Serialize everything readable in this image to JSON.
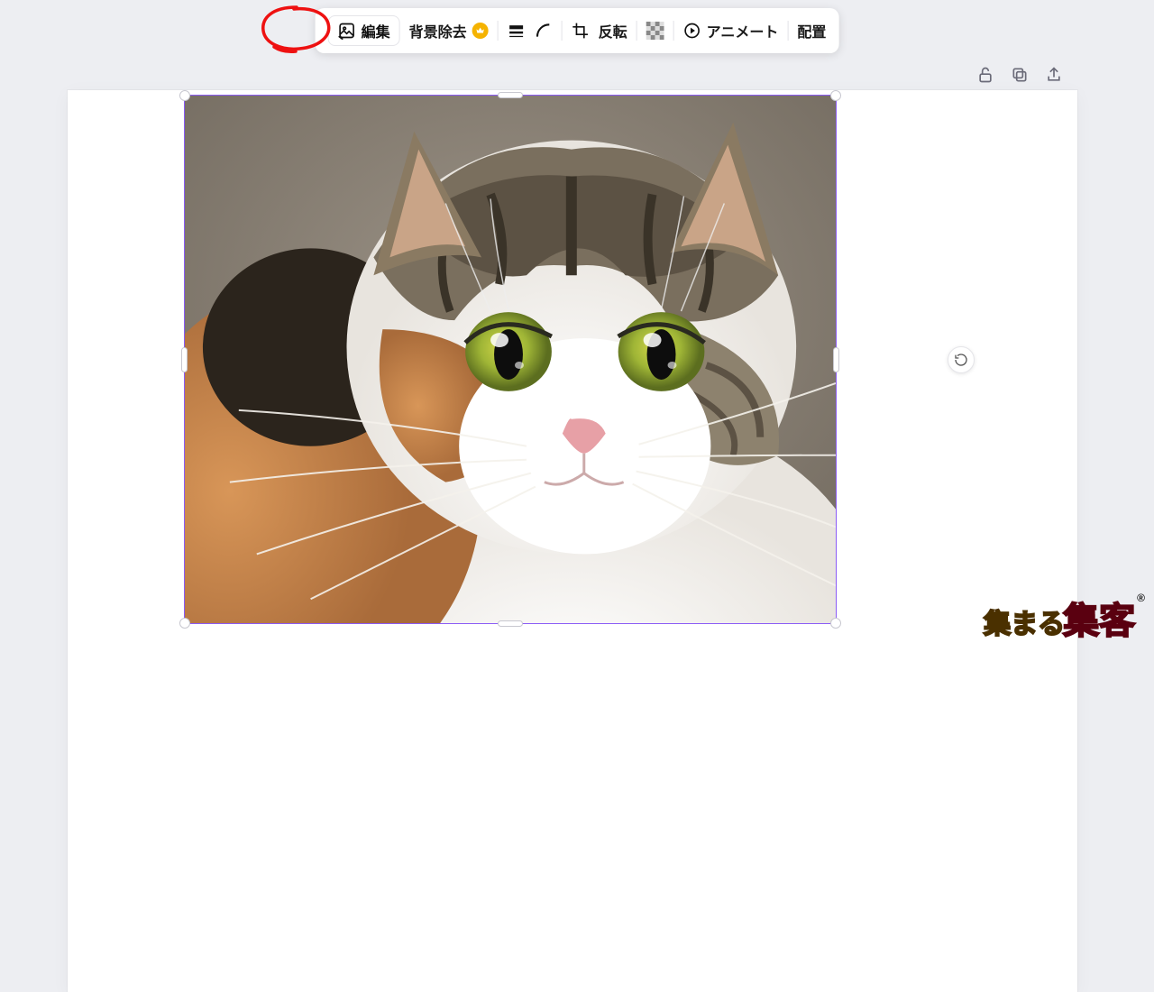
{
  "toolbar": {
    "edit_label": "編集",
    "bg_remove_label": "背景除去",
    "flip_label": "反転",
    "animate_label": "アニメート",
    "position_label": "配置"
  },
  "icons": {
    "edit": "edit-image-icon",
    "premium": "crown-icon",
    "weight": "line-weight-icon",
    "corner": "corner-radius-icon",
    "crop": "crop-icon",
    "transparency": "transparency-icon",
    "animate": "animate-icon",
    "lock": "unlock-icon",
    "duplicate": "duplicate-icon",
    "upload": "share-icon",
    "rotate": "rotate-icon"
  },
  "selection": {
    "border_color": "#8b5cf6"
  },
  "watermark": {
    "part_a": "集まる",
    "part_b": "集客",
    "reg": "®"
  },
  "image": {
    "subject": "calico-cat",
    "description": "A close-up photo of a calico cat with green eyes"
  }
}
